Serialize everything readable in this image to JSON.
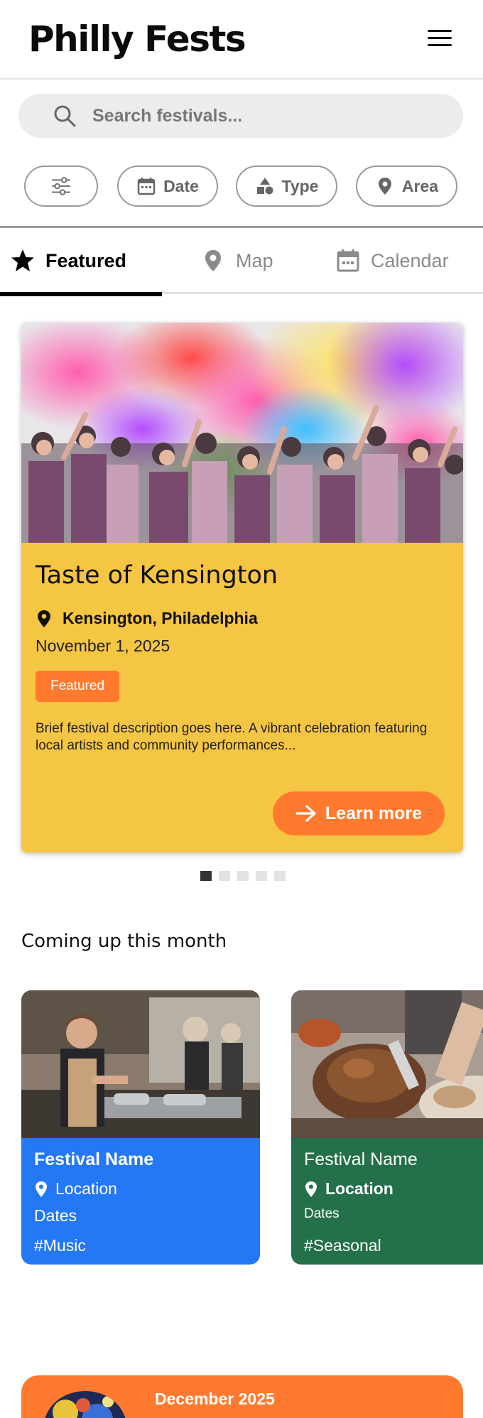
{
  "header": {
    "logo": "Philly Fests",
    "menu_icon": "hamburger-menu-icon"
  },
  "search": {
    "placeholder": "Search festivals...",
    "value": ""
  },
  "filters": [
    {
      "label": "",
      "icon": "sliders-icon"
    },
    {
      "label": "Date",
      "icon": "calendar-icon"
    },
    {
      "label": "Type",
      "icon": "shapes-icon"
    },
    {
      "label": "Area",
      "icon": "map-pin-icon"
    }
  ],
  "tabs": [
    {
      "label": "Featured",
      "icon": "star-icon",
      "active": true
    },
    {
      "label": "Map",
      "icon": "map-pin-icon",
      "active": false
    },
    {
      "label": "Calendar",
      "icon": "calendar-icon",
      "active": false
    }
  ],
  "featured": {
    "title": "Taste of Kensington",
    "location": "Kensington, Philadelphia",
    "date": "November 1, 2025",
    "badge": "Featured",
    "description": "Brief festival description goes here. A vibrant celebration featuring local artists and community performances...",
    "button": "Learn more",
    "color": "#f5c544",
    "accent": "#ff7a2e"
  },
  "carousel": {
    "count": 5,
    "active_index": 0
  },
  "month_section": {
    "title": "Coming up this month",
    "cards": [
      {
        "name": "Festival Name",
        "location": "Location",
        "dates": "Dates",
        "tag": "#Music",
        "color": "#2478f5"
      },
      {
        "name": "Festival Name",
        "location": "Location",
        "dates": "Dates",
        "tag": "#Seasonal",
        "color": "#23704a"
      }
    ]
  },
  "promo": {
    "title": "December 2025",
    "color": "#ff7a2e"
  }
}
